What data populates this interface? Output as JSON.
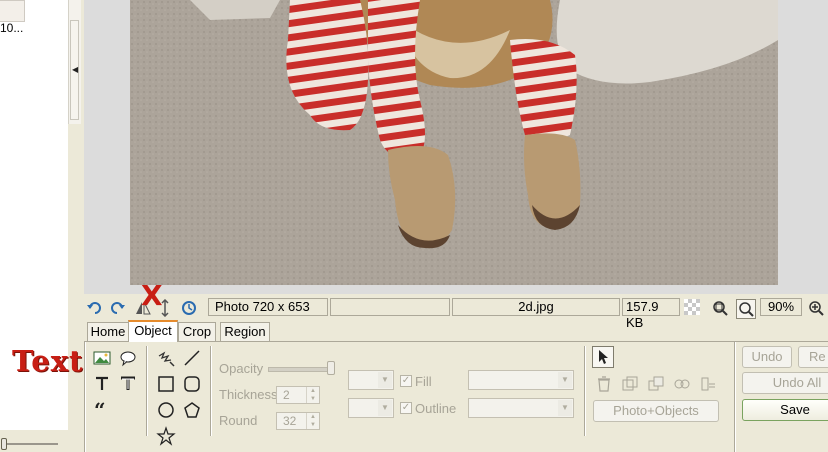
{
  "file_panel": {
    "thumbnail_label": "10..."
  },
  "status_bar": {
    "photo_info": "Photo 720 x 653",
    "empty_field": "",
    "filename": "2d.jpg",
    "filesize": "157.9 KB",
    "zoom": "90%"
  },
  "tabs": [
    {
      "label": "Home"
    },
    {
      "label": "Object",
      "active": true
    },
    {
      "label": "Crop"
    },
    {
      "label": "Region"
    }
  ],
  "object_panel": {
    "opacity_label": "Opacity",
    "thickness_label": "Thickness",
    "thickness_value": "2",
    "round_label": "Round",
    "round_value": "32",
    "fill_label": "Fill",
    "outline_label": "Outline",
    "photo_objects_button": "Photo+Objects"
  },
  "right_buttons": {
    "undo": "Undo",
    "redo": "Re",
    "undo_all": "Undo All",
    "save": "Save"
  },
  "annotations": {
    "text_label": "Text",
    "x_mark": "X"
  },
  "colors": {
    "accent_tab": "#e68b2c",
    "annotation_red": "#c81e14",
    "panel_bg": "#ece9d8"
  }
}
